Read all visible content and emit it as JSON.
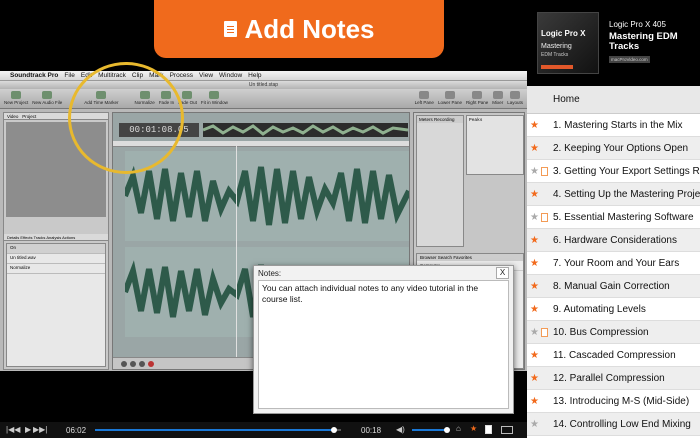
{
  "banner": {
    "label": "Add Notes",
    "icon": "document-icon"
  },
  "app": {
    "name": "Soundtrack Pro",
    "menu": [
      "File",
      "Edit",
      "Multitrack",
      "Clip",
      "Mark",
      "Process",
      "View",
      "Window",
      "Help"
    ],
    "window_title": "Un titled.stap",
    "toolbar": [
      "New Project",
      "New Audio File",
      "Add Time Marker",
      "Normalize",
      "Fade In",
      "Fade Out",
      "Fit in Window"
    ],
    "toolbar_right": [
      "Left Pane",
      "Lower Pane",
      "Right Pane",
      "Mixer",
      "Layouts"
    ],
    "left_tabs": [
      "Video",
      "Project"
    ],
    "lower_tabs": [
      "Details",
      "Effects",
      "Tracks",
      "Analysis",
      "Actions"
    ],
    "actions": [
      "On",
      "Un titled.wav",
      "Normalize"
    ],
    "timecode": "00:01:08.05",
    "right_tabs": [
      "Meters",
      "Recording"
    ],
    "peaks_label": "Peaks",
    "browser_tabs": [
      "Browser",
      "Search",
      "Favorites"
    ],
    "browser_path": "Computer",
    "browser_item": "278 Tool"
  },
  "notes": {
    "title": "Notes:",
    "close": "X",
    "text": "You can attach individual notes to any video tutorial in the course list."
  },
  "player": {
    "elapsed": "06:02",
    "remaining": "00:18",
    "progress": 0.97,
    "volume": 0.9,
    "accent": "#1a78d6"
  },
  "course": {
    "series": "Logic Pro X 405",
    "title": "Mastering EDM Tracks",
    "cover_lines": [
      "Logic Pro X",
      "Mastering",
      "EDM Tracks"
    ],
    "cover_badge": "macProVideo.com",
    "home": "Home",
    "lessons": [
      {
        "label": "1. Mastering Starts in the Mix",
        "star": "orange",
        "note": false
      },
      {
        "label": "2. Keeping Your Options Open",
        "star": "orange",
        "note": false
      },
      {
        "label": "3. Getting Your Export Settings Right",
        "star": "gray",
        "note": true
      },
      {
        "label": "4. Setting Up the Mastering Project",
        "star": "orange",
        "note": false
      },
      {
        "label": "5. Essential Mastering Software",
        "star": "gray",
        "note": true
      },
      {
        "label": "6. Hardware Considerations",
        "star": "orange",
        "note": false
      },
      {
        "label": "7. Your Room and Your Ears",
        "star": "orange",
        "note": false
      },
      {
        "label": "8. Manual Gain Correction",
        "star": "orange",
        "note": false
      },
      {
        "label": "9.  Automating Levels",
        "star": "orange",
        "note": false
      },
      {
        "label": "10. Bus Compression",
        "star": "gray",
        "note": true
      },
      {
        "label": "11. Cascaded Compression",
        "star": "orange",
        "note": false
      },
      {
        "label": "12. Parallel Compression",
        "star": "orange",
        "note": false
      },
      {
        "label": "13. Introducing M-S (Mid-Side)",
        "star": "orange",
        "note": false
      },
      {
        "label": "14. Controlling Low End Mixing",
        "star": "gray",
        "note": false
      }
    ]
  },
  "colors": {
    "accent": "#f06a1c",
    "highlight": "#e8b92e"
  }
}
